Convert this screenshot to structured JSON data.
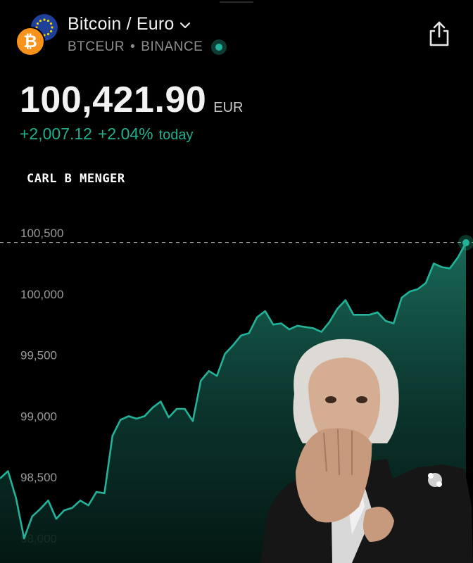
{
  "header": {
    "pair_title": "Bitcoin / Euro",
    "symbol": "BTCEUR",
    "separator": "•",
    "exchange": "BINANCE",
    "icons": [
      "euro-flag-icon",
      "bitcoin-icon",
      "chevron-down-icon",
      "share-icon",
      "live-status-icon"
    ]
  },
  "quote": {
    "price": "100,421.90",
    "currency": "EUR",
    "change_abs": "+2,007.12",
    "change_pct": "+2.04%",
    "change_when": "today"
  },
  "watermark": "CARL B MENGER",
  "colors": {
    "accent": "#1fb08f",
    "line": "#22b39a",
    "background": "#000000",
    "bitcoin": "#f7931a",
    "euro": "#1e3f9a"
  },
  "chart_data": {
    "type": "area",
    "ylim": [
      97950,
      100900
    ],
    "y_ticks": [
      100500,
      100000,
      99500,
      99000,
      98500,
      98000
    ],
    "y_tick_labels": [
      "100,500",
      "100,000",
      "99,500",
      "99,000",
      "98,500",
      "98,000"
    ],
    "reference_line": 100421.9,
    "x": [
      0,
      1,
      2,
      3,
      4,
      5,
      6,
      7,
      8,
      9,
      10,
      11,
      12,
      13,
      14,
      15,
      16,
      17,
      18,
      19,
      20,
      21,
      22,
      23,
      24,
      25,
      26,
      27,
      28,
      29,
      30,
      31,
      32,
      33,
      34,
      35,
      36,
      37,
      38,
      39,
      40,
      41,
      42,
      43,
      44,
      45,
      46,
      47,
      48,
      49,
      50,
      51,
      52,
      53,
      54,
      55,
      56,
      57,
      58,
      59,
      60
    ],
    "values": [
      98490,
      98550,
      98330,
      98000,
      98180,
      98240,
      98310,
      98160,
      98230,
      98250,
      98310,
      98270,
      98380,
      98370,
      98840,
      98970,
      99000,
      98980,
      99000,
      99070,
      99120,
      98990,
      99060,
      99060,
      98960,
      99290,
      99370,
      99330,
      99510,
      99580,
      99660,
      99680,
      99810,
      99860,
      99750,
      99760,
      99710,
      99740,
      99730,
      99720,
      99690,
      99770,
      99880,
      99950,
      99830,
      99830,
      99830,
      99850,
      99780,
      99760,
      99970,
      100020,
      100040,
      100090,
      100250,
      100220,
      100210,
      100300,
      100420
    ]
  }
}
